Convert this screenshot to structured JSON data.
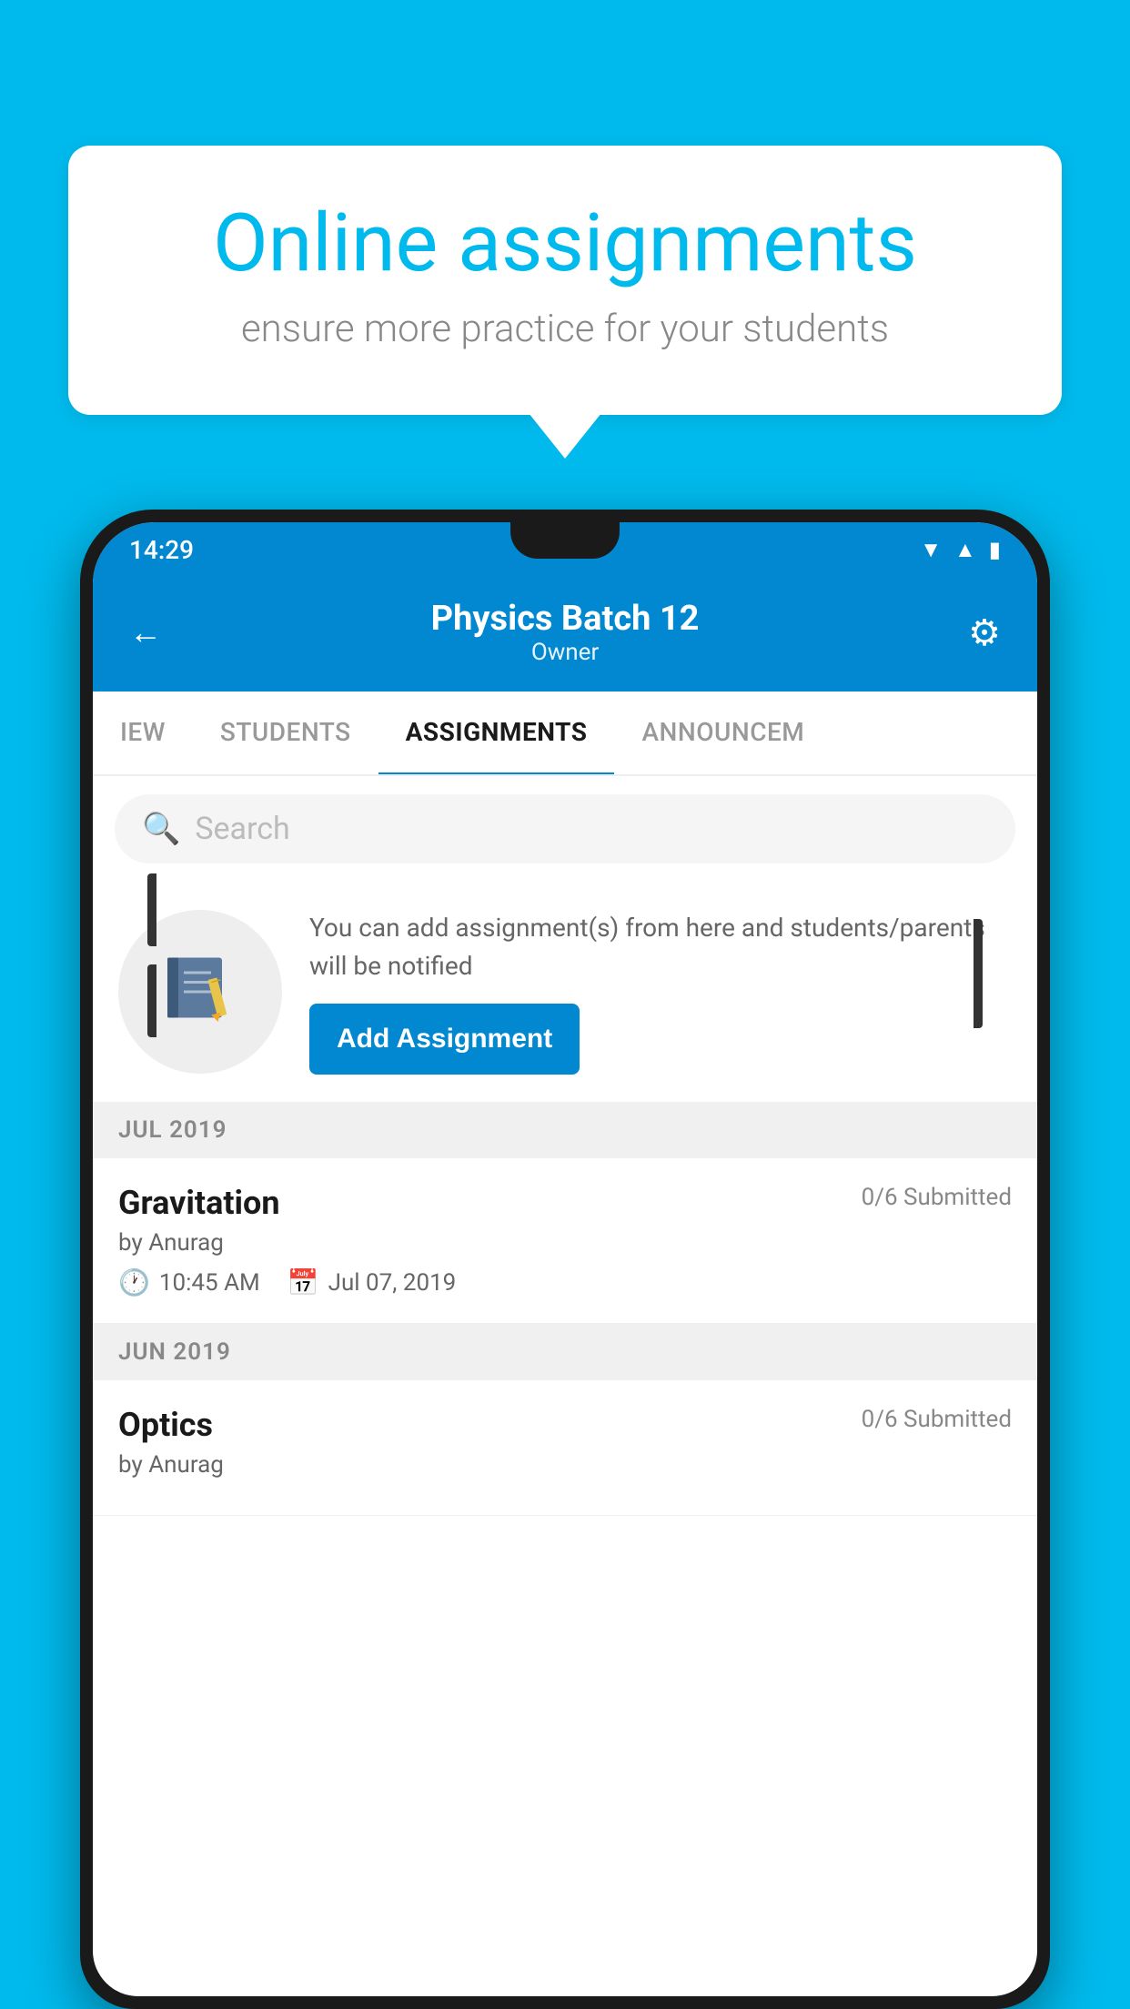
{
  "background_color": "#00BAED",
  "speech_bubble": {
    "title": "Online assignments",
    "subtitle": "ensure more practice for your students"
  },
  "status_bar": {
    "time": "14:29",
    "icons": [
      "wifi",
      "signal",
      "battery"
    ]
  },
  "app_header": {
    "title": "Physics Batch 12",
    "subtitle": "Owner",
    "back_label": "←",
    "gear_label": "⚙"
  },
  "tabs": [
    {
      "label": "IEW",
      "active": false
    },
    {
      "label": "STUDENTS",
      "active": false
    },
    {
      "label": "ASSIGNMENTS",
      "active": true
    },
    {
      "label": "ANNOUNCEM",
      "active": false
    }
  ],
  "search": {
    "placeholder": "Search"
  },
  "promo": {
    "text": "You can add assignment(s) from here and students/parents will be notified",
    "button_label": "Add Assignment"
  },
  "sections": [
    {
      "label": "JUL 2019",
      "assignments": [
        {
          "name": "Gravitation",
          "submitted": "0/6 Submitted",
          "by": "by Anurag",
          "time": "10:45 AM",
          "date": "Jul 07, 2019"
        }
      ]
    },
    {
      "label": "JUN 2019",
      "assignments": [
        {
          "name": "Optics",
          "submitted": "0/6 Submitted",
          "by": "by Anurag",
          "time": "",
          "date": ""
        }
      ]
    }
  ]
}
